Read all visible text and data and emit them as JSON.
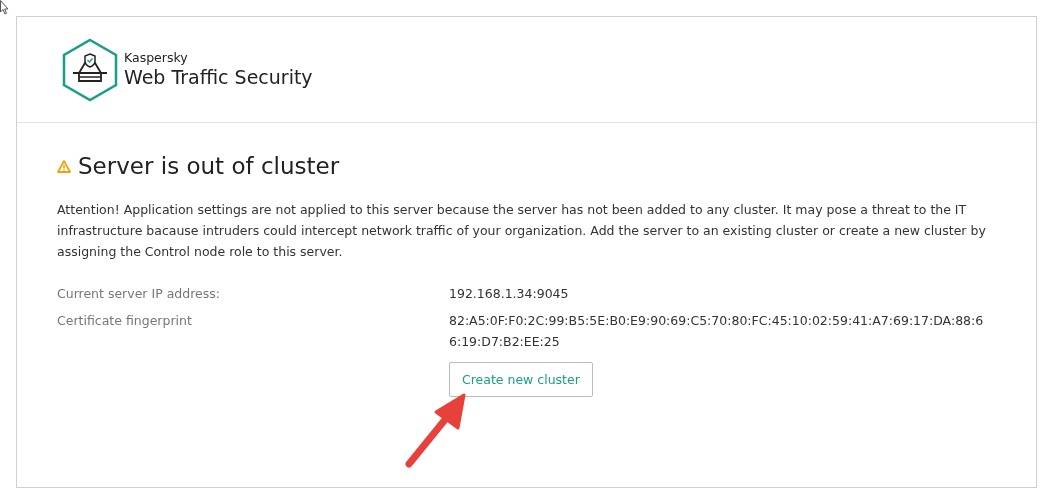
{
  "header": {
    "brand": "Kaspersky",
    "product": "Web Traffic Security"
  },
  "title": "Server is out of cluster",
  "message": "Attention! Application settings are not applied to this server because the server has not been added to any cluster. It may pose a threat to the IT infrastructure bacause intruders could intercept network traffic of your organization. Add the server to an existing cluster or create a new cluster by assigning the Control node role to this server.",
  "details": [
    {
      "label": "Current server IP address:",
      "value": "192.168.1.34:9045"
    },
    {
      "label": "Certificate fingerprint",
      "value": "82:A5:0F:F0:2C:99:B5:5E:B0:E9:90:69:C5:70:80:FC:45:10:02:59:41:A7:69:17:DA:88:66:19:D7:B2:EE:25"
    }
  ],
  "button": "Create new cluster"
}
